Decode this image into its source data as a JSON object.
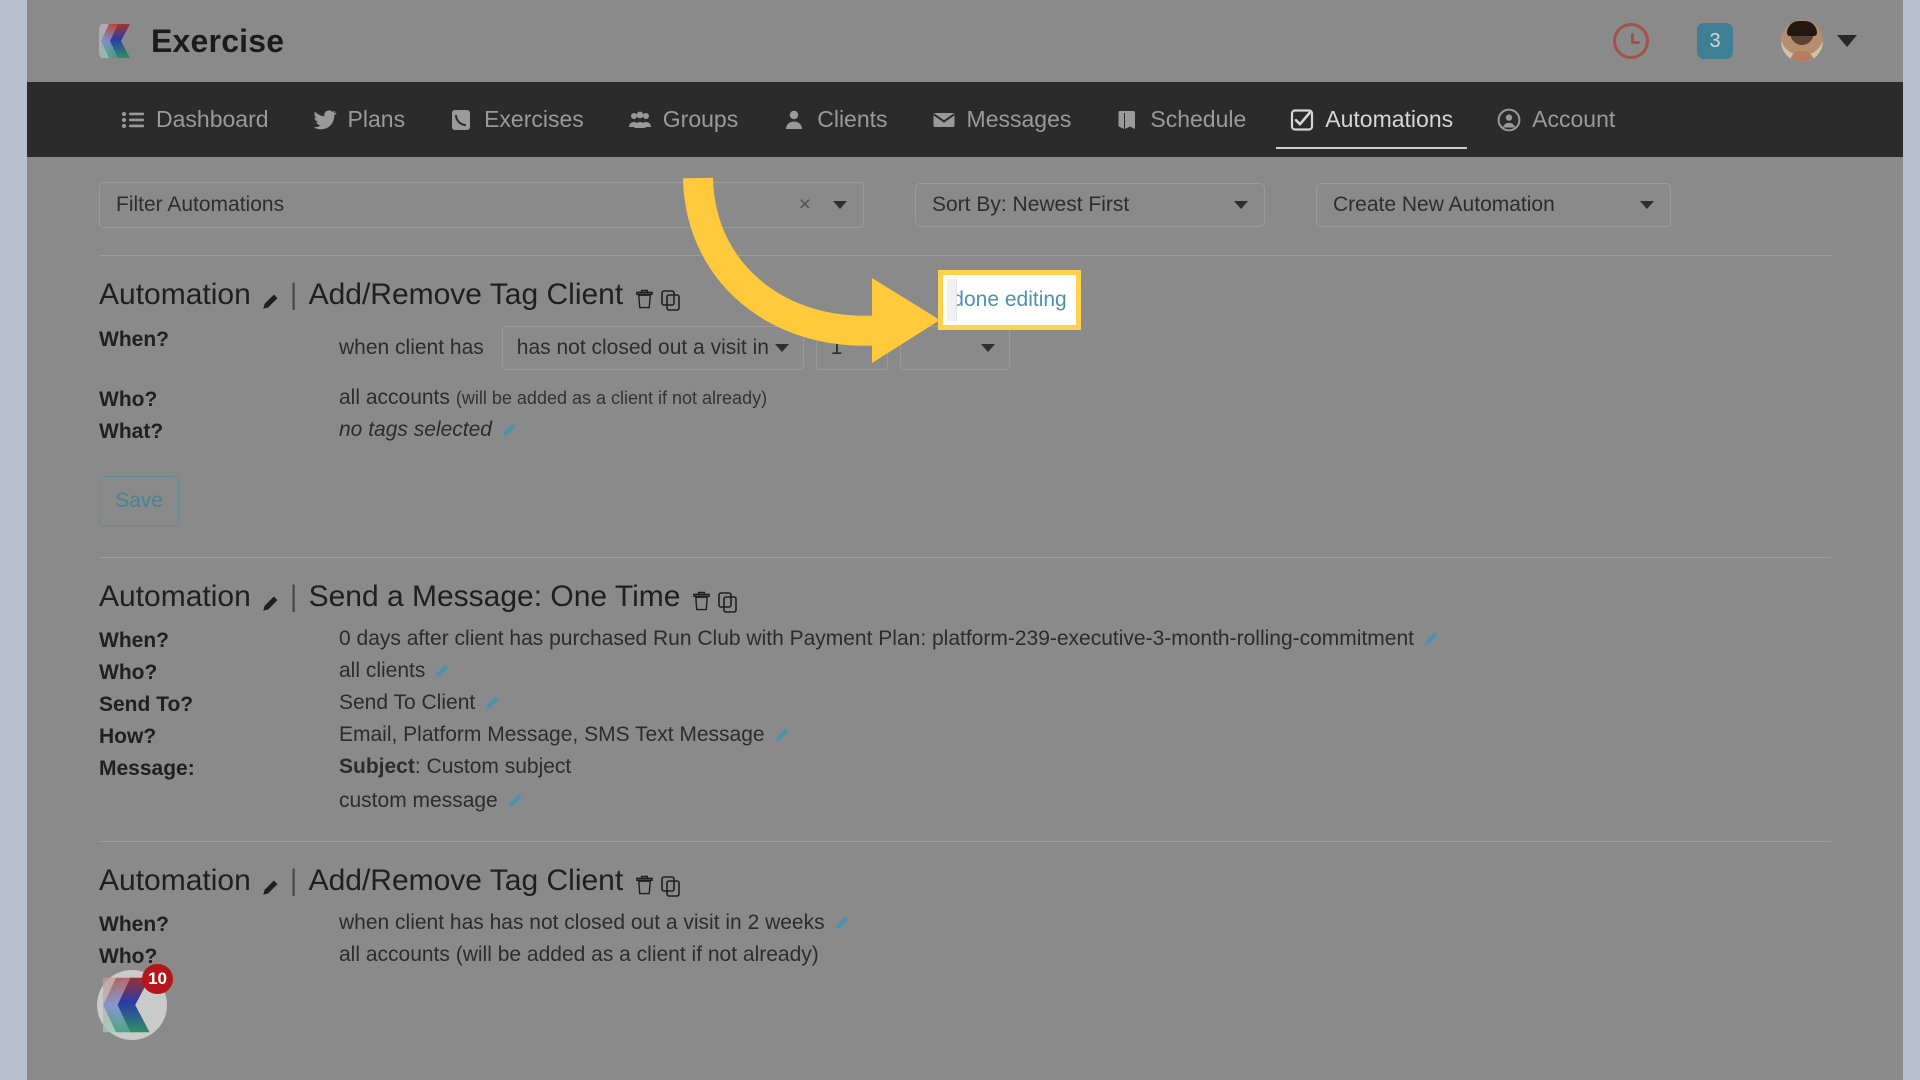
{
  "app": {
    "brand": "Exercise",
    "logo_icon": "chevron-logo"
  },
  "header": {
    "clock_icon": "clock-icon",
    "notification_count": "3",
    "avatar_icon": "avatar",
    "caret_icon": "chevron-down-icon"
  },
  "nav": {
    "items": [
      {
        "label": "Dashboard",
        "icon": "list-icon",
        "active": false
      },
      {
        "label": "Plans",
        "icon": "bird-icon",
        "active": false
      },
      {
        "label": "Exercises",
        "icon": "phone-icon",
        "active": false
      },
      {
        "label": "Groups",
        "icon": "people-icon",
        "active": false
      },
      {
        "label": "Clients",
        "icon": "user-icon",
        "active": false
      },
      {
        "label": "Messages",
        "icon": "envelope-icon",
        "active": false
      },
      {
        "label": "Schedule",
        "icon": "book-icon",
        "active": false
      },
      {
        "label": "Automations",
        "icon": "check-square-icon",
        "active": true
      },
      {
        "label": "Account",
        "icon": "user-circle-icon",
        "active": false
      }
    ]
  },
  "controls": {
    "filter": {
      "label": "Filter Automations",
      "clear_icon": "close-icon",
      "caret_icon": "caret-down-icon"
    },
    "sort": {
      "label": "Sort By: Newest First",
      "caret_icon": "caret-down-icon"
    },
    "create": {
      "label": "Create New Automation",
      "caret_icon": "caret-down-icon"
    }
  },
  "automations": [
    {
      "prefix": "Automation",
      "separator": "|",
      "name": "Add/Remove Tag Client",
      "edit_icon": "pencil-icon",
      "delete_icon": "trash-icon",
      "copy_icon": "copy-icon",
      "editing": true,
      "when": {
        "label": "When?",
        "prefix": "when client has",
        "condition": "has not closed out a visit in",
        "amount": "1",
        "unit": "",
        "done_label": "done editing"
      },
      "who": {
        "label": "Who?",
        "value": "all accounts",
        "note": "(will be added as a client if not already)"
      },
      "what": {
        "label": "What?",
        "value": "no tags selected",
        "edit_icon": "pencil-icon"
      },
      "save_label": "Save"
    },
    {
      "prefix": "Automation",
      "separator": "|",
      "name": "Send a Message: One Time",
      "edit_icon": "pencil-icon",
      "delete_icon": "trash-icon",
      "copy_icon": "copy-icon",
      "rows": [
        {
          "label": "When?",
          "value": "0 days after client has purchased Run Club with Payment Plan: platform-239-executive-3-month-rolling-commitment",
          "edit_icon": "pencil-icon"
        },
        {
          "label": "Who?",
          "value": "all clients",
          "edit_icon": "pencil-icon"
        },
        {
          "label": "Send To?",
          "value": "Send To Client",
          "edit_icon": "pencil-icon"
        },
        {
          "label": "How?",
          "value": "Email, Platform Message, SMS Text Message",
          "edit_icon": "pencil-icon"
        }
      ],
      "message": {
        "label": "Message:",
        "subject_label": "Subject",
        "subject_value": ": Custom subject",
        "body": "custom message",
        "edit_icon": "pencil-icon"
      }
    },
    {
      "prefix": "Automation",
      "separator": "|",
      "name": "Add/Remove Tag Client",
      "edit_icon": "pencil-icon",
      "delete_icon": "trash-icon",
      "copy_icon": "copy-icon",
      "rows": [
        {
          "label": "When?",
          "value": "when client has has not closed out a visit in 2 weeks",
          "edit_icon": "pencil-icon"
        },
        {
          "label": "Who?",
          "value": "all accounts (will be added as a client if not already)",
          "edit_icon": ""
        }
      ]
    }
  ],
  "overlay": {
    "arrow_icon": "curved-arrow-icon",
    "highlight_target": "done editing"
  },
  "fab": {
    "icon": "chevron-logo",
    "badge": "10"
  },
  "colors": {
    "nav_bg": "#2b2b2b",
    "accent_teal": "#4a93ad",
    "highlight_yellow": "#ffd24d",
    "badge_red": "#b5161b",
    "badge_teal": "#3e7f94"
  }
}
